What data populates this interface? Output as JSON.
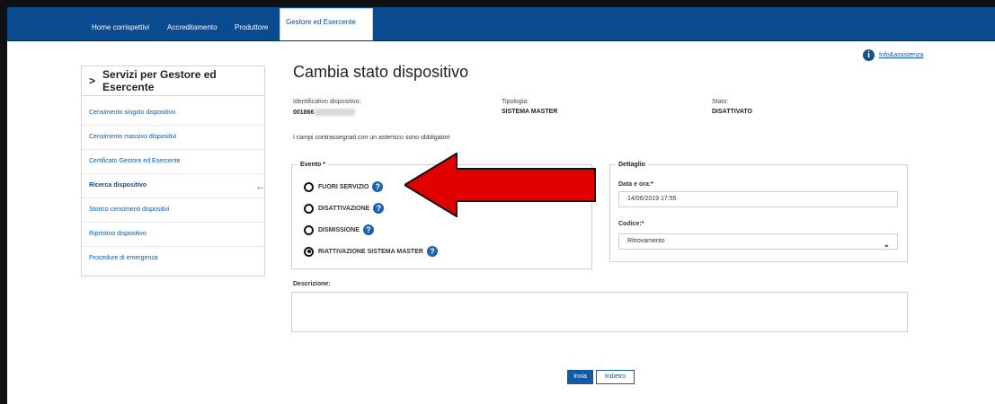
{
  "nav": {
    "items": [
      "Home corrispettivi",
      "Accreditamento",
      "Produttore"
    ],
    "active": "Gestore ed Esercente"
  },
  "info": {
    "link": "Info&assistenza"
  },
  "sidebar": {
    "title": "Servizi per Gestore ed Esercente",
    "items": [
      {
        "label": "Censimento singolo dispositivo"
      },
      {
        "label": "Censimento massivo dispositivi"
      },
      {
        "label": "Certificato Gestore ed Esercente"
      },
      {
        "label": "Ricerca dispositivo"
      },
      {
        "label": "Storico censimenti dispositivi"
      },
      {
        "label": "Ripristino dispositivo"
      },
      {
        "label": "Procedure di emergenza"
      }
    ],
    "active_index": 3
  },
  "page": {
    "title": "Cambia stato dispositivo",
    "id_label": "Identificativo dispositivo:",
    "id_value": "001866",
    "type_label": "Tipologia:",
    "type_value": "SISTEMA MASTER",
    "state_label": "Stato:",
    "state_value": "DISATTIVATO",
    "note": "I campi contrassegnati con un asterisco sono obbligatori"
  },
  "evento": {
    "legend": "Evento *",
    "options": [
      {
        "label": "FUORI SERVIZIO",
        "checked": false
      },
      {
        "label": "DISATTIVAZIONE",
        "checked": false
      },
      {
        "label": "DISMISSIONE",
        "checked": false
      },
      {
        "label": "RIATTIVAZIONE SISTEMA MASTER",
        "checked": true
      }
    ],
    "help_glyph": "?"
  },
  "dettaglio": {
    "legend": "Dettaglio",
    "date_label": "Data e ora:*",
    "date_value": "14/06/2019 17:55",
    "code_label": "Codice:*",
    "code_value": "Ritrovamento"
  },
  "descrizione": {
    "label": "Descrizione:",
    "value": ""
  },
  "buttons": {
    "submit": "Invia",
    "back": "Indietro"
  },
  "colors": {
    "navbar": "#0a4a8f",
    "accent": "#1659a8",
    "arrow": "#e00000"
  }
}
